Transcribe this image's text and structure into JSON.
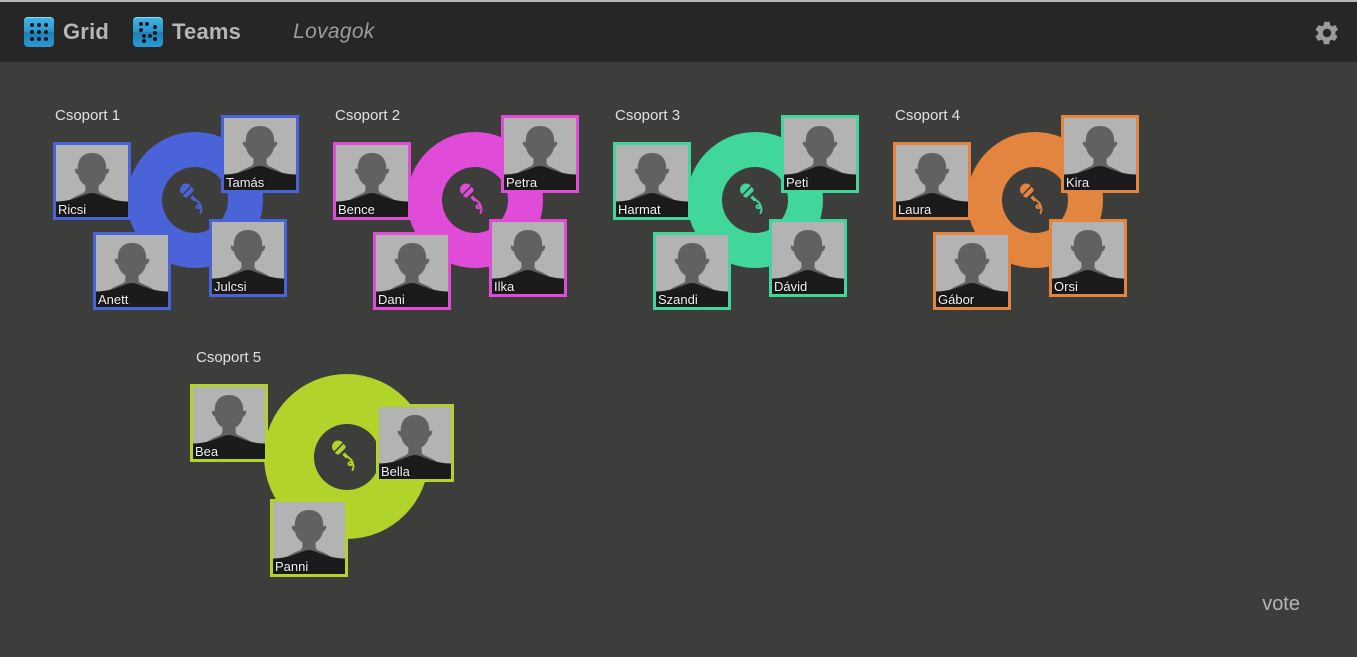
{
  "header": {
    "nav": [
      {
        "label": "Grid",
        "icon": "grid-dice-icon"
      },
      {
        "label": "Teams",
        "icon": "teams-dice-icon"
      }
    ],
    "title": "Lovagok",
    "settings_icon": "gear-icon"
  },
  "footer": {
    "vote_label": "vote"
  },
  "colors": {
    "background": "#3d3d3b",
    "topbar": "#262626",
    "group1": "#4a63d8",
    "group2": "#e04bd8",
    "group3": "#41d69a",
    "group4": "#e3843f",
    "group5": "#b2d42a",
    "mic_badge": "#3d3d3b",
    "avatar_bg": "#b3b3b3",
    "avatar_head": "#616161",
    "avatar_shoulder": "#1e1e1e",
    "text": "#e2e2e2"
  },
  "groups": [
    {
      "title": "Csoport 1",
      "color": "#4a63d8",
      "mic_icon": "microphone-icon",
      "members": [
        {
          "name": "Ricsi",
          "pos": "top-left"
        },
        {
          "name": "Tamás",
          "pos": "top-right"
        },
        {
          "name": "Anett",
          "pos": "bottom-left"
        },
        {
          "name": "Julcsi",
          "pos": "bottom-right"
        }
      ]
    },
    {
      "title": "Csoport 2",
      "color": "#e04bd8",
      "mic_icon": "microphone-icon",
      "members": [
        {
          "name": "Bence",
          "pos": "top-left"
        },
        {
          "name": "Petra",
          "pos": "top-right"
        },
        {
          "name": "Dani",
          "pos": "bottom-left"
        },
        {
          "name": "Ilka",
          "pos": "bottom-right"
        }
      ]
    },
    {
      "title": "Csoport 3",
      "color": "#41d69a",
      "mic_icon": "microphone-icon",
      "members": [
        {
          "name": "Harmat",
          "pos": "top-left"
        },
        {
          "name": "Peti",
          "pos": "top-right"
        },
        {
          "name": "Szandi",
          "pos": "bottom-left"
        },
        {
          "name": "Dávid",
          "pos": "bottom-right"
        }
      ]
    },
    {
      "title": "Csoport 4",
      "color": "#e3843f",
      "mic_icon": "microphone-icon",
      "members": [
        {
          "name": "Laura",
          "pos": "top-left"
        },
        {
          "name": "Kira",
          "pos": "top-right"
        },
        {
          "name": "Gábor",
          "pos": "bottom-left"
        },
        {
          "name": "Orsi",
          "pos": "bottom-right"
        }
      ]
    },
    {
      "title": "Csoport 5",
      "color": "#b2d42a",
      "mic_icon": "microphone-icon",
      "members": [
        {
          "name": "Bea",
          "pos": "left"
        },
        {
          "name": "Bella",
          "pos": "right"
        },
        {
          "name": "Panni",
          "pos": "bottom"
        }
      ]
    }
  ]
}
